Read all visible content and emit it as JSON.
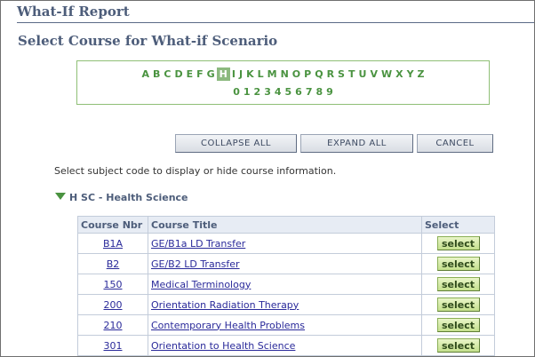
{
  "header": {
    "title": "What-If Report"
  },
  "page_title": "Select Course for What-if Scenario",
  "alphabet": {
    "letters": [
      "A",
      "B",
      "C",
      "D",
      "E",
      "F",
      "G",
      "H",
      "I",
      "J",
      "K",
      "L",
      "M",
      "N",
      "O",
      "P",
      "Q",
      "R",
      "S",
      "T",
      "U",
      "V",
      "W",
      "X",
      "Y",
      "Z"
    ],
    "digits": [
      "0",
      "1",
      "2",
      "3",
      "4",
      "5",
      "6",
      "7",
      "8",
      "9"
    ],
    "selected": "H"
  },
  "buttons": {
    "collapse_all": "COLLAPSE ALL",
    "expand_all": "EXPAND ALL",
    "cancel": "CANCEL"
  },
  "instruction": "Select subject code to display or hide course information.",
  "subject": {
    "label": "H SC - Health Science"
  },
  "table": {
    "headers": {
      "nbr": "Course Nbr",
      "title": "Course Title",
      "select": "Select"
    },
    "rows": [
      {
        "nbr": "B1A",
        "title": "GE/B1a LD Transfer",
        "action": "select"
      },
      {
        "nbr": "B2",
        "title": "GE/B2 LD Transfer",
        "action": "select"
      },
      {
        "nbr": "150",
        "title": "Medical Terminology",
        "action": "select"
      },
      {
        "nbr": "200",
        "title": "Orientation Radiation Therapy",
        "action": "select"
      },
      {
        "nbr": "210",
        "title": "Contemporary Health Problems",
        "action": "select"
      },
      {
        "nbr": "301",
        "title": "Orientation to Health Science",
        "action": "select"
      }
    ]
  }
}
